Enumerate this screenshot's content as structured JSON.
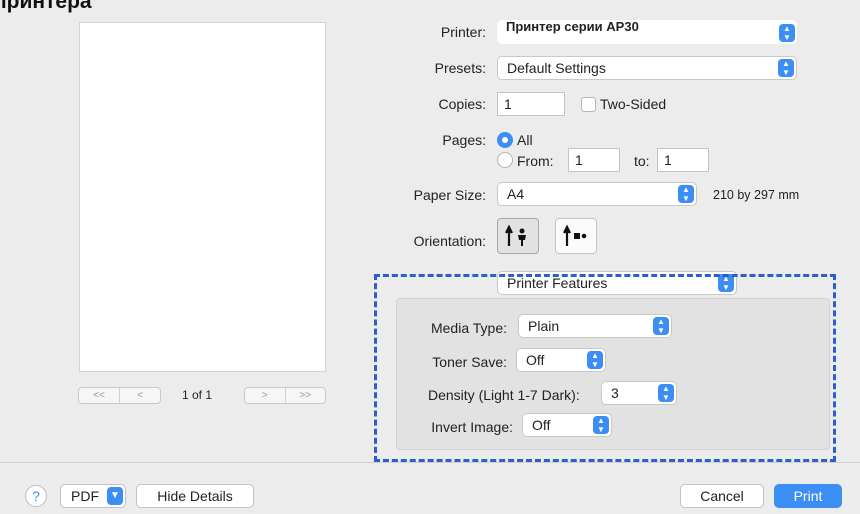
{
  "heading": "принтера",
  "preview": {
    "first_label": "<<",
    "prev_label": "<",
    "next_label": ">",
    "last_label": ">>",
    "page_indicator": "1 of 1"
  },
  "printer": {
    "label": "Printer:",
    "value": "Принтер серии AP30"
  },
  "presets": {
    "label": "Presets:",
    "value": "Default Settings"
  },
  "copies": {
    "label": "Copies:",
    "value": "1",
    "two_sided_label": "Two-Sided"
  },
  "pages": {
    "label": "Pages:",
    "all_label": "All",
    "from_label": "From:",
    "from_value": "1",
    "to_label": "to:",
    "to_value": "1"
  },
  "paper_size": {
    "label": "Paper Size:",
    "value": "A4",
    "dims": "210 by 297 mm"
  },
  "orientation": {
    "label": "Orientation:"
  },
  "section": {
    "value": "Printer Features"
  },
  "features": {
    "media_type": {
      "label": "Media Type:",
      "value": "Plain"
    },
    "toner_save": {
      "label": "Toner Save:",
      "value": "Off"
    },
    "density": {
      "label": "Density (Light 1-7 Dark):",
      "value": "3"
    },
    "invert_image": {
      "label": "Invert Image:",
      "value": "Off"
    }
  },
  "footer": {
    "help_label": "?",
    "pdf_label": "PDF",
    "hide_details_label": "Hide Details",
    "cancel_label": "Cancel",
    "print_label": "Print"
  },
  "colors": {
    "accent": "#3c8ef5",
    "highlight_dash": "#2a5fd3"
  }
}
